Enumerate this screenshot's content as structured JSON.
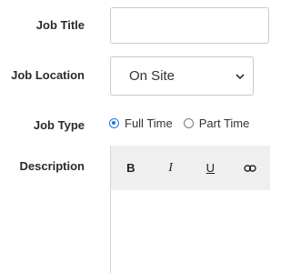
{
  "form": {
    "job_title": {
      "label": "Job Title",
      "value": ""
    },
    "job_location": {
      "label": "Job Location",
      "selected": "On Site"
    },
    "job_type": {
      "label": "Job Type",
      "options": [
        {
          "label": "Full Time",
          "checked": true
        },
        {
          "label": "Part Time",
          "checked": false
        }
      ]
    },
    "description": {
      "label": "Description",
      "toolbar": {
        "bold": "B",
        "italic": "I",
        "underline": "U"
      },
      "value": ""
    }
  },
  "colors": {
    "accent": "#1a73e8",
    "toolbar_bg": "#efefef",
    "border": "#c9c9c9"
  }
}
